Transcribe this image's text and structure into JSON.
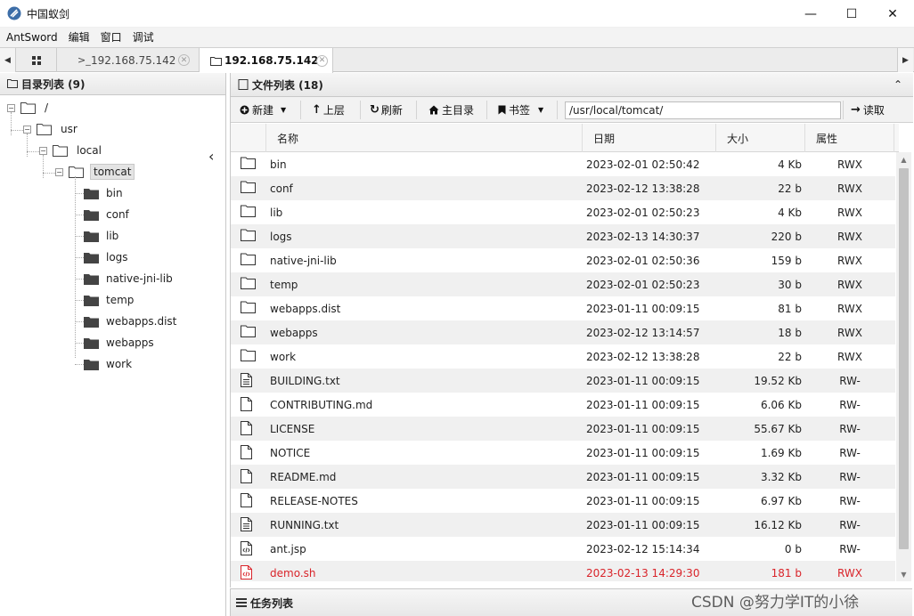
{
  "window": {
    "title": "中国蚁剑",
    "minimize": "—",
    "maximize": "☐",
    "close": "✕"
  },
  "menu": [
    "AntSword",
    "编辑",
    "窗口",
    "调试"
  ],
  "tabs": [
    {
      "label": "192.168.75.142",
      "prefix": ">_",
      "active": false
    },
    {
      "label": "192.168.75.142",
      "active": true
    }
  ],
  "tab_close": "✕",
  "left_panel": {
    "title": "目录列表 (9)",
    "collapse": "‹"
  },
  "tree": {
    "root": "/",
    "usr": "usr",
    "local": "local",
    "tomcat": "tomcat",
    "children": [
      "bin",
      "conf",
      "lib",
      "logs",
      "native-jni-lib",
      "temp",
      "webapps.dist",
      "webapps",
      "work"
    ]
  },
  "right_panel": {
    "title": "文件列表 (18)",
    "collapse": "⌃"
  },
  "toolbar": {
    "new": "新建",
    "up": "上层",
    "refresh": "刷新",
    "home": "主目录",
    "bookmark": "书签",
    "path": "/usr/local/tomcat/",
    "read": "读取"
  },
  "columns": [
    "名称",
    "日期",
    "大小",
    "属性"
  ],
  "files": [
    {
      "name": "bin",
      "date": "2023-02-01 02:50:42",
      "size": "4 Kb",
      "attr": "RWX",
      "kind": "folder"
    },
    {
      "name": "conf",
      "date": "2023-02-12 13:38:28",
      "size": "22 b",
      "attr": "RWX",
      "kind": "folder"
    },
    {
      "name": "lib",
      "date": "2023-02-01 02:50:23",
      "size": "4 Kb",
      "attr": "RWX",
      "kind": "folder"
    },
    {
      "name": "logs",
      "date": "2023-02-13 14:30:37",
      "size": "220 b",
      "attr": "RWX",
      "kind": "folder"
    },
    {
      "name": "native-jni-lib",
      "date": "2023-02-01 02:50:36",
      "size": "159 b",
      "attr": "RWX",
      "kind": "folder"
    },
    {
      "name": "temp",
      "date": "2023-02-01 02:50:23",
      "size": "30 b",
      "attr": "RWX",
      "kind": "folder"
    },
    {
      "name": "webapps.dist",
      "date": "2023-01-11 00:09:15",
      "size": "81 b",
      "attr": "RWX",
      "kind": "folder"
    },
    {
      "name": "webapps",
      "date": "2023-02-12 13:14:57",
      "size": "18 b",
      "attr": "RWX",
      "kind": "folder"
    },
    {
      "name": "work",
      "date": "2023-02-12 13:38:28",
      "size": "22 b",
      "attr": "RWX",
      "kind": "folder"
    },
    {
      "name": "BUILDING.txt",
      "date": "2023-01-11 00:09:15",
      "size": "19.52 Kb",
      "attr": "RW-",
      "kind": "text"
    },
    {
      "name": "CONTRIBUTING.md",
      "date": "2023-01-11 00:09:15",
      "size": "6.06 Kb",
      "attr": "RW-",
      "kind": "file"
    },
    {
      "name": "LICENSE",
      "date": "2023-01-11 00:09:15",
      "size": "55.67 Kb",
      "attr": "RW-",
      "kind": "file"
    },
    {
      "name": "NOTICE",
      "date": "2023-01-11 00:09:15",
      "size": "1.69 Kb",
      "attr": "RW-",
      "kind": "file"
    },
    {
      "name": "README.md",
      "date": "2023-01-11 00:09:15",
      "size": "3.32 Kb",
      "attr": "RW-",
      "kind": "file"
    },
    {
      "name": "RELEASE-NOTES",
      "date": "2023-01-11 00:09:15",
      "size": "6.97 Kb",
      "attr": "RW-",
      "kind": "file"
    },
    {
      "name": "RUNNING.txt",
      "date": "2023-01-11 00:09:15",
      "size": "16.12 Kb",
      "attr": "RW-",
      "kind": "text"
    },
    {
      "name": "ant.jsp",
      "date": "2023-02-12 15:14:34",
      "size": "0 b",
      "attr": "RW-",
      "kind": "code"
    },
    {
      "name": "demo.sh",
      "date": "2023-02-13 14:29:30",
      "size": "181 b",
      "attr": "RWX",
      "kind": "code",
      "highlight": "#d9242a"
    }
  ],
  "task_panel": {
    "title": "任务列表"
  },
  "watermark": "CSDN @努力学IT的小徐"
}
